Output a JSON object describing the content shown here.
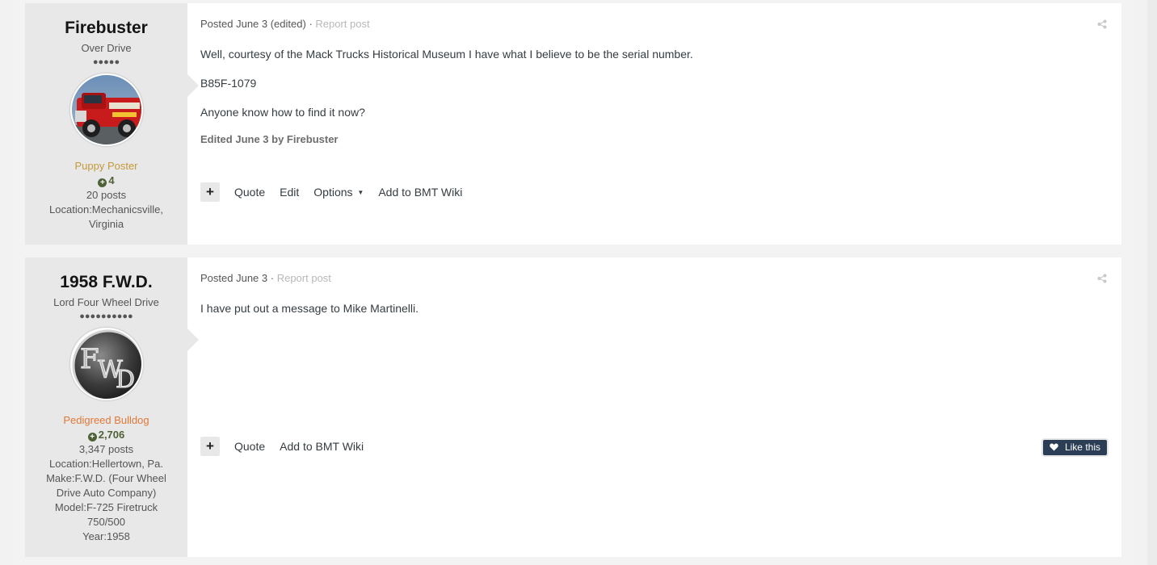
{
  "posts": [
    {
      "author": "Firebuster",
      "title": "Over Drive",
      "pips": "●●●●●",
      "group": "Puppy Poster",
      "group_color": "#c49a3a",
      "reputation": "4",
      "post_count": "20 posts",
      "meta": [
        "Location:Mechanicsville, Virginia"
      ],
      "posted": "Posted June 3 (edited)",
      "report": "Report post",
      "body": [
        "Well, courtesy of the Mack Trucks Historical Museum I have what I believe to be the serial number.",
        "B85F-1079",
        "Anyone know how to find it now?"
      ],
      "edited": "Edited June 3 by Firebuster",
      "actions": [
        "Quote",
        "Edit",
        "Options",
        "Add to BMT Wiki"
      ]
    },
    {
      "author": "1958 F.W.D.",
      "title": "Lord Four Wheel Drive",
      "pips": "●●●●●●●●●●",
      "group": "Pedigreed Bulldog",
      "group_color": "#e07838",
      "reputation": "2,706",
      "post_count": "3,347 posts",
      "meta": [
        "Location:Hellertown, Pa.",
        "Make:F.W.D. (Four Wheel Drive Auto Company)",
        "Model:F-725 Firetruck 750/500",
        "Year:1958"
      ],
      "posted": "Posted June 3",
      "report": "Report post",
      "body": [
        "I have put out a message to Mike Martinelli."
      ],
      "actions": [
        "Quote",
        "Add to BMT Wiki"
      ],
      "like_label": "Like this"
    }
  ],
  "icons": {
    "share": "share-icon",
    "plus": "plus-icon",
    "heart": "heart-icon",
    "caret": "caret-down-icon",
    "rep": "plus-circle-icon"
  }
}
